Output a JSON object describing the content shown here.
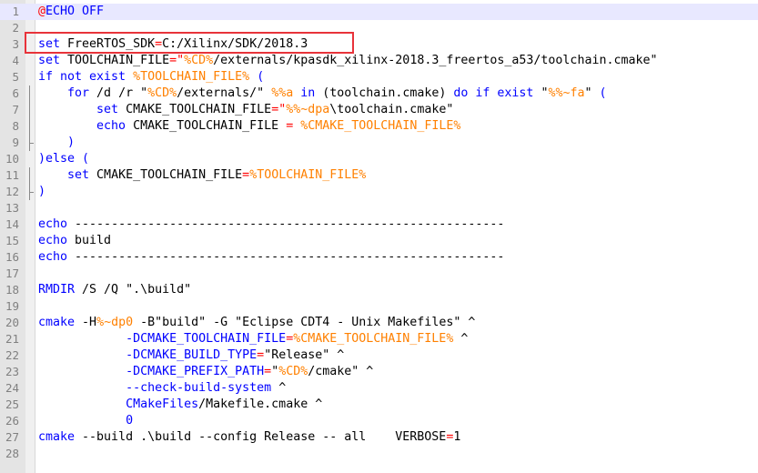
{
  "colors": {
    "keyword": "#0000ff",
    "variable": "#ff8000",
    "operator": "#ff0000",
    "text": "#000000",
    "gutter_bg": "#e4e4e4",
    "line_number": "#808080",
    "current_line_bg": "#e8e8ff",
    "annotation_box": "#e8333a"
  },
  "editor": {
    "current_line": 1,
    "annotation_line": 3,
    "lines": [
      {
        "number": "1",
        "tokens": [
          {
            "t": "@",
            "k": "op"
          },
          {
            "t": "ECHO OFF",
            "k": "kw"
          }
        ]
      },
      {
        "number": "2",
        "tokens": []
      },
      {
        "number": "3",
        "tokens": [
          {
            "t": "set",
            "k": "kw"
          },
          {
            "t": " FreeRTOS_SDK",
            "k": "plain"
          },
          {
            "t": "=",
            "k": "op"
          },
          {
            "t": "C:/Xilinx/SDK/2018.3",
            "k": "plain"
          }
        ]
      },
      {
        "number": "4",
        "tokens": [
          {
            "t": "set",
            "k": "kw"
          },
          {
            "t": " TOOLCHAIN_FILE",
            "k": "plain"
          },
          {
            "t": "=\"",
            "k": "op"
          },
          {
            "t": "%CD%",
            "k": "var"
          },
          {
            "t": "/externals/kpasdk_xilinx-2018.3_freertos_a53/toolchain.cmake\"",
            "k": "plain"
          }
        ]
      },
      {
        "number": "5",
        "tokens": [
          {
            "t": "if not exist",
            "k": "kw"
          },
          {
            "t": " ",
            "k": "plain"
          },
          {
            "t": "%TOOLCHAIN_FILE%",
            "k": "var"
          },
          {
            "t": " (",
            "k": "kw"
          }
        ]
      },
      {
        "number": "6",
        "tokens": [
          {
            "t": "    for",
            "k": "kw"
          },
          {
            "t": " /d /r \"",
            "k": "plain"
          },
          {
            "t": "%CD%",
            "k": "var"
          },
          {
            "t": "/externals/\" ",
            "k": "plain"
          },
          {
            "t": "%%a",
            "k": "var"
          },
          {
            "t": " in",
            "k": "kw"
          },
          {
            "t": " (toolchain.cmake) ",
            "k": "plain"
          },
          {
            "t": "do if exist",
            "k": "kw"
          },
          {
            "t": " \"",
            "k": "plain"
          },
          {
            "t": "%%~fa",
            "k": "var"
          },
          {
            "t": "\" ",
            "k": "plain"
          },
          {
            "t": "(",
            "k": "kw"
          }
        ]
      },
      {
        "number": "7",
        "tokens": [
          {
            "t": "        set",
            "k": "kw"
          },
          {
            "t": " CMAKE_TOOLCHAIN_FILE",
            "k": "plain"
          },
          {
            "t": "=\"",
            "k": "op"
          },
          {
            "t": "%%~dpa",
            "k": "var"
          },
          {
            "t": "\\toolchain.cmake\"",
            "k": "plain"
          }
        ]
      },
      {
        "number": "8",
        "tokens": [
          {
            "t": "        echo",
            "k": "kw"
          },
          {
            "t": " CMAKE_TOOLCHAIN_FILE ",
            "k": "plain"
          },
          {
            "t": "=",
            "k": "op"
          },
          {
            "t": " ",
            "k": "plain"
          },
          {
            "t": "%CMAKE_TOOLCHAIN_FILE%",
            "k": "var"
          }
        ]
      },
      {
        "number": "9",
        "tokens": [
          {
            "t": "    )",
            "k": "kw"
          }
        ]
      },
      {
        "number": "10",
        "tokens": [
          {
            "t": ")else (",
            "k": "kw"
          }
        ]
      },
      {
        "number": "11",
        "tokens": [
          {
            "t": "    set",
            "k": "kw"
          },
          {
            "t": " CMAKE_TOOLCHAIN_FILE",
            "k": "plain"
          },
          {
            "t": "=",
            "k": "op"
          },
          {
            "t": "%TOOLCHAIN_FILE%",
            "k": "var"
          }
        ]
      },
      {
        "number": "12",
        "tokens": [
          {
            "t": ")",
            "k": "kw"
          }
        ]
      },
      {
        "number": "13",
        "tokens": []
      },
      {
        "number": "14",
        "tokens": [
          {
            "t": "echo",
            "k": "kw"
          },
          {
            "t": " -----------------------------------------------------------",
            "k": "plain"
          }
        ]
      },
      {
        "number": "15",
        "tokens": [
          {
            "t": "echo",
            "k": "kw"
          },
          {
            "t": " build",
            "k": "plain"
          }
        ]
      },
      {
        "number": "16",
        "tokens": [
          {
            "t": "echo",
            "k": "kw"
          },
          {
            "t": " -----------------------------------------------------------",
            "k": "plain"
          }
        ]
      },
      {
        "number": "17",
        "tokens": []
      },
      {
        "number": "18",
        "tokens": [
          {
            "t": "RMDIR",
            "k": "kw"
          },
          {
            "t": " /S /Q \".\\build\"",
            "k": "plain"
          }
        ]
      },
      {
        "number": "19",
        "tokens": []
      },
      {
        "number": "20",
        "tokens": [
          {
            "t": "cmake",
            "k": "kw"
          },
          {
            "t": " -H",
            "k": "plain"
          },
          {
            "t": "%~dp0",
            "k": "var"
          },
          {
            "t": " -B\"build\" -G \"Eclipse CDT4 - Unix Makefiles\" ^",
            "k": "plain"
          }
        ]
      },
      {
        "number": "21",
        "tokens": [
          {
            "t": "            -DCMAKE_TOOLCHAIN_FILE",
            "k": "kw"
          },
          {
            "t": "=",
            "k": "op"
          },
          {
            "t": "%CMAKE_TOOLCHAIN_FILE%",
            "k": "var"
          },
          {
            "t": " ^",
            "k": "plain"
          }
        ]
      },
      {
        "number": "22",
        "tokens": [
          {
            "t": "            -DCMAKE_BUILD_TYPE",
            "k": "kw"
          },
          {
            "t": "=",
            "k": "op"
          },
          {
            "t": "\"Release\" ^",
            "k": "plain"
          }
        ]
      },
      {
        "number": "23",
        "tokens": [
          {
            "t": "            -DCMAKE_PREFIX_PATH",
            "k": "kw"
          },
          {
            "t": "=",
            "k": "op"
          },
          {
            "t": "\"",
            "k": "plain"
          },
          {
            "t": "%CD%",
            "k": "var"
          },
          {
            "t": "/cmake\" ^",
            "k": "plain"
          }
        ]
      },
      {
        "number": "24",
        "tokens": [
          {
            "t": "            --check-build-system",
            "k": "kw"
          },
          {
            "t": " ^",
            "k": "plain"
          }
        ]
      },
      {
        "number": "25",
        "tokens": [
          {
            "t": "            CMakeFiles",
            "k": "kw"
          },
          {
            "t": "/Makefile.cmake ^",
            "k": "plain"
          }
        ]
      },
      {
        "number": "26",
        "tokens": [
          {
            "t": "            0",
            "k": "kw"
          }
        ]
      },
      {
        "number": "27",
        "tokens": [
          {
            "t": "cmake",
            "k": "kw"
          },
          {
            "t": " --build .\\build --config Release -- all    VERBOSE",
            "k": "plain"
          },
          {
            "t": "=",
            "k": "op"
          },
          {
            "t": "1",
            "k": "plain"
          }
        ]
      },
      {
        "number": "28",
        "tokens": []
      }
    ]
  }
}
